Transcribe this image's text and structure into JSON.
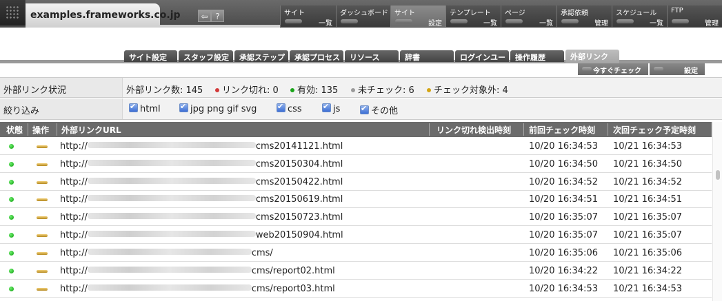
{
  "header": {
    "site_name": "examples.frameworks.co.jp",
    "back_icon": "back-arrow-icon",
    "help_label": "?",
    "nav": [
      {
        "title": "サイト",
        "sub": "一覧"
      },
      {
        "title": "ダッシュボード",
        "sub": ""
      },
      {
        "title": "サイト",
        "sub": "設定"
      },
      {
        "title": "テンプレート",
        "sub": "一覧"
      },
      {
        "title": "ページ",
        "sub": "一覧"
      },
      {
        "title": "承認依頼",
        "sub": "管理"
      },
      {
        "title": "スケジュール",
        "sub": "一覧"
      },
      {
        "title": "FTP",
        "sub": "管理"
      }
    ]
  },
  "tabs": [
    "サイト設定",
    "スタッフ設定",
    "承認ステップ",
    "承認プロセス",
    "リソース",
    "辞書",
    "ログインユーザ",
    "操作履歴",
    "外部リンク"
  ],
  "actions": {
    "check_now": "今すぐチェック",
    "settings": "設定"
  },
  "status": {
    "label": "外部リンク状況",
    "total": "外部リンク数: 145",
    "broken": "リンク切れ: 0",
    "valid": "有効: 135",
    "unchecked": "未チェック: 6",
    "excluded": "チェック対象外: 4",
    "colors": {
      "broken": "#d33a3a",
      "valid": "#1aa51a",
      "unchecked": "#9a9a9a",
      "excluded": "#d4a514"
    }
  },
  "filter": {
    "label": "絞り込み",
    "options": [
      "html",
      "jpg png gif svg",
      "css",
      "js",
      "その他"
    ]
  },
  "table": {
    "headers": [
      "状態",
      "操作",
      "外部リンクURL",
      "リンク切れ検出時刻",
      "前回チェック時刻",
      "次回チェック予定時刻"
    ],
    "rows": [
      {
        "url_prefix": "http://",
        "url_suffix": "cms20141121.html",
        "broken": "",
        "prev": "10/20 16:34:53",
        "next": "10/21 16:34:53"
      },
      {
        "url_prefix": "http://",
        "url_suffix": "cms20150304.html",
        "broken": "",
        "prev": "10/20 16:34:50",
        "next": "10/21 16:34:50"
      },
      {
        "url_prefix": "http://",
        "url_suffix": "cms20150422.html",
        "broken": "",
        "prev": "10/20 16:34:52",
        "next": "10/21 16:34:52"
      },
      {
        "url_prefix": "http://",
        "url_suffix": "cms20150619.html",
        "broken": "",
        "prev": "10/20 16:34:51",
        "next": "10/21 16:34:51"
      },
      {
        "url_prefix": "http://",
        "url_suffix": "cms20150723.html",
        "broken": "",
        "prev": "10/20 16:35:07",
        "next": "10/21 16:35:07"
      },
      {
        "url_prefix": "http://",
        "url_suffix": "web20150904.html",
        "broken": "",
        "prev": "10/20 16:35:07",
        "next": "10/21 16:35:07"
      },
      {
        "url_prefix": "http://",
        "url_suffix": "cms/",
        "broken": "",
        "prev": "10/20 16:35:06",
        "next": "10/21 16:35:06"
      },
      {
        "url_prefix": "http://",
        "url_suffix": "cms/report02.html",
        "broken": "",
        "prev": "10/20 16:34:22",
        "next": "10/21 16:34:22"
      },
      {
        "url_prefix": "http://",
        "url_suffix": "cms/report03.html",
        "broken": "",
        "prev": "10/20 16:34:53",
        "next": "10/21 16:34:53"
      }
    ]
  }
}
